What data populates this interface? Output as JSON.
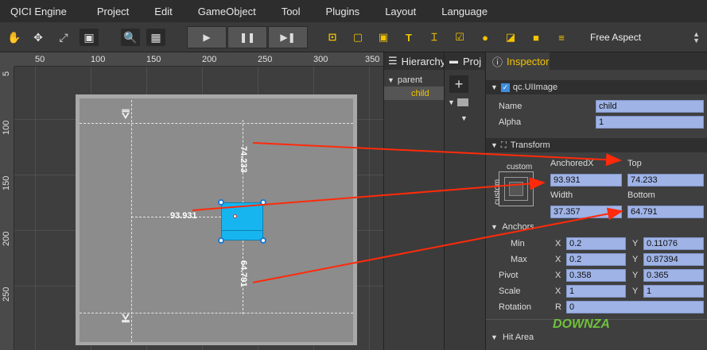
{
  "menu": [
    "QICI Engine",
    "Project",
    "Edit",
    "GameObject",
    "Tool",
    "Plugins",
    "Layout",
    "Language"
  ],
  "toolbar": {
    "aspect": "Free Aspect",
    "icons": [
      "hand-icon",
      "move-icon",
      "scale-icon",
      "rect-icon",
      "zoom-icon",
      "grid-icon",
      "play-icon",
      "pause-icon",
      "step-icon"
    ]
  },
  "scene": {
    "ruler_top": [
      "50",
      "100",
      "150",
      "200",
      "250",
      "300",
      "350"
    ],
    "ruler_left": [
      "5",
      "100",
      "150",
      "200",
      "250"
    ],
    "meas_left": "93.931",
    "meas_top": "74.233",
    "meas_bottom": "64.791"
  },
  "hierarchy": {
    "title": "Hierarchy",
    "items": [
      "parent",
      "child"
    ]
  },
  "project": {
    "title": "Proj"
  },
  "inspector": {
    "title": "Inspector",
    "component": "qc.UIImage",
    "name_label": "Name",
    "name_value": "child",
    "alpha_label": "Alpha",
    "alpha_value": "1",
    "transform_label": "Transform",
    "custom_top": "custom",
    "custom_side": "custom",
    "anchoredx_label": "AnchoredX",
    "anchoredx_value": "93.931",
    "top_label": "Top",
    "top_value": "74.233",
    "width_label": "Width",
    "width_value": "37.357",
    "bottom_label": "Bottom",
    "bottom_value": "64.791",
    "anchors_label": "Anchors",
    "min_label": "Min",
    "max_label": "Max",
    "x_label": "X",
    "y_label": "Y",
    "anchor_min_x": "0.2",
    "anchor_min_y": "0.11076",
    "anchor_max_x": "0.2",
    "anchor_max_y": "0.87394",
    "pivot_label": "Pivot",
    "pivot_x": "0.358",
    "pivot_y": "0.365",
    "scale_label": "Scale",
    "scale_x": "1",
    "scale_y": "1",
    "rotation_label": "Rotation",
    "r_label": "R",
    "rotation_value": "0",
    "hitarea_label": "Hit Area"
  },
  "watermark": "DOWNZA"
}
